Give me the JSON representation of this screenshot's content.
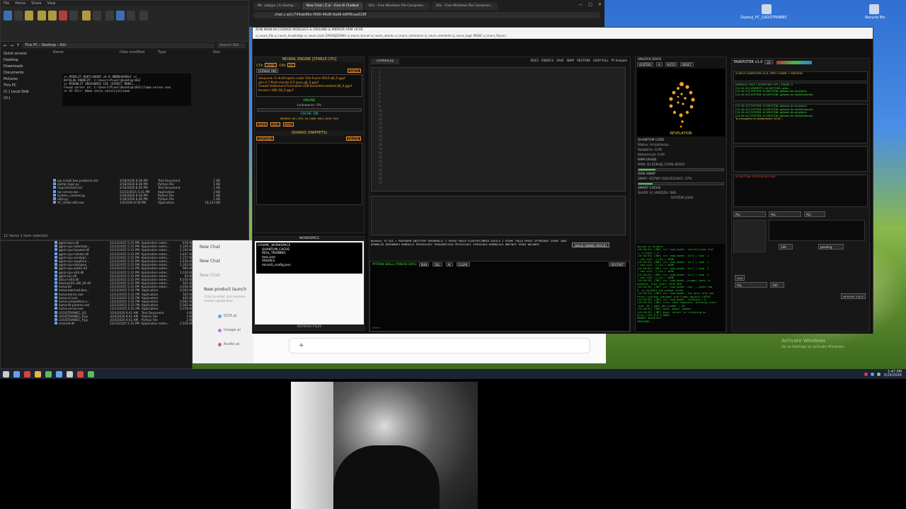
{
  "explorer": {
    "tabs": [
      "File",
      "Home",
      "Share",
      "View"
    ],
    "address": "This PC › Desktop › AGI",
    "search_placeholder": "Search AGI",
    "nav": [
      "Quick access",
      "Desktop",
      "Downloads",
      "Documents",
      "Pictures",
      "This PC",
      "(C:) Local Disk",
      "(D:)"
    ],
    "columns": [
      "Name",
      "Date modified",
      "Type",
      "Size"
    ],
    "files": [
      {
        "name": "pip install bee problems.txt",
        "date": "2/18/2026 8:36 PM",
        "type": "Text Document",
        "size": "1 KB"
      },
      {
        "name": "portal_logic.py",
        "date": "2/18/2026 8:36 PM",
        "type": "Python File",
        "size": "1 KB"
      },
      {
        "name": "requirements.txt",
        "date": "2/18/2026 8:36 PM",
        "type": "Text Document",
        "size": "1 KB"
      },
      {
        "name": "rpc-server.exe",
        "date": "12/23/2025 5:31 PM",
        "type": "Application",
        "size": "3 KB"
      },
      {
        "name": "system_context.py",
        "date": "2/18/2026 8:36 PM",
        "type": "Python File",
        "size": "1 KB"
      },
      {
        "name": "utils.py",
        "date": "2/18/2026 8:36 PM",
        "type": "Python File",
        "size": "1 KB"
      },
      {
        "name": "VC_redist.x64.exe",
        "date": "1/4/2026 8:56 PM",
        "type": "Application",
        "size": "18,124 KB"
      }
    ],
    "status": "11 items  1 item selected",
    "console_lines": [
      ">> MIROLIT BOOTLOADER v6.0 UNBREAKABLE <<",
      "KATALOG ROBOCZY: C:\\Users\\Pixel\\Desktop\\AGI",
      ">> MIROBLIT URUCHAMIA SIĘ (DIRECT MODE)...",
      "Found server at: C:\\Users\\Pixel\\Desktop\\AGI\\llama-server.exe",
      ">> AI Słir: Nowa sesja zainicjalizowa"
    ]
  },
  "explorer2": {
    "files": [
      {
        "name": "ggml-base.dll",
        "date": "12/23/2025 5:31 PM",
        "type": "Application exten...",
        "size": "678 KB"
      },
      {
        "name": "ggml-cpu-alderlake...",
        "date": "12/23/2025 5:31 PM",
        "type": "Application exten...",
        "size": "1,195 KB"
      },
      {
        "name": "ggml-cpu-haswell.dll",
        "date": "12/23/2025 5:31 PM",
        "type": "Application exten...",
        "size": "1,194 KB"
      },
      {
        "name": "ggml-cpu-icelake.dll",
        "date": "12/23/2025 5:31 PM",
        "type": "Application exten...",
        "size": "1,407 KB"
      },
      {
        "name": "ggml-cpu-sandybri...",
        "date": "12/23/2025 5:31 PM",
        "type": "Application exten...",
        "size": "1,157 KB"
      },
      {
        "name": "ggml-cpu-sapphire...",
        "date": "12/23/2025 5:31 PM",
        "type": "Application exten...",
        "size": "1,426 KB"
      },
      {
        "name": "ggml-cpu-skylakex...",
        "date": "12/23/2025 5:31 PM",
        "type": "Application exten...",
        "size": "1,303 KB"
      },
      {
        "name": "ggml-cpu-sse42.dll",
        "date": "12/23/2025 5:31 PM",
        "type": "Application exten...",
        "size": "965 KB"
      },
      {
        "name": "ggml-cpu-x64.dll",
        "date": "12/23/2025 5:31 PM",
        "type": "Application exten...",
        "size": "1,020 KB"
      },
      {
        "name": "ggml-rpc.dll",
        "date": "12/23/2025 5:31 PM",
        "type": "Application exten...",
        "size": "83 KB"
      },
      {
        "name": "libcurl-x64.dll",
        "date": "12/23/2025 5:31 PM",
        "type": "Application exten...",
        "size": "4,010 KB"
      },
      {
        "name": "libomp140.x86_64.dll",
        "date": "12/23/2025 5:31 PM",
        "type": "Application exten...",
        "size": "645 KB"
      },
      {
        "name": "llama.dll",
        "date": "12/23/2025 5:31 PM",
        "type": "Application exten...",
        "size": "2,656 KB"
      },
      {
        "name": "llama-batched-ben...",
        "date": "12/23/2025 5:31 PM",
        "type": "Application",
        "size": "2,003 KB"
      },
      {
        "name": "llama-bench.exe",
        "date": "12/23/2025 5:31 PM",
        "type": "Application",
        "size": "325 KB"
      },
      {
        "name": "llama-cli.exe",
        "date": "12/23/2025 5:31 PM",
        "type": "Application",
        "size": "405 KB"
      },
      {
        "name": "llama-completion.e...",
        "date": "12/23/2025 5:31 PM",
        "type": "Application",
        "size": "2,662 KB"
      },
      {
        "name": "llama-fit-params.exe",
        "date": "12/23/2025 5:31 PM",
        "type": "Application",
        "size": "2,562 KB"
      },
      {
        "name": "llama-server.exe",
        "date": "12/23/2025 5:31 PM",
        "type": "Application",
        "size": "2,378 KB"
      },
      {
        "name": "LOGISTRANIEC_LO...",
        "date": "3/24/2026 8:41 AM",
        "type": "Text Document",
        "size": "4 KB"
      },
      {
        "name": "LOGISTRANIEC_P.py",
        "date": "3/24/2026 8:41 AM",
        "type": "Python File",
        "size": "2 KB"
      },
      {
        "name": "LOGISTRANIEC_P.py",
        "date": "3/24/2026 8:41 AM",
        "type": "Python File",
        "size": "2 KB"
      },
      {
        "name": "mmmdl.dll",
        "date": "12/23/2025 5:31 PM",
        "type": "Application exten...",
        "size": "2,556 KB"
      }
    ]
  },
  "chat": {
    "sidebar_items": [
      "New Chat",
      "New Chat",
      "New Chat"
    ],
    "launch_title": "New product launch",
    "launch_sub": "Click to enter and explore model capabilities",
    "chips": [
      "OCR.ai",
      "Image.ai",
      "Audio.ai"
    ],
    "plus": "+"
  },
  "browser": {
    "tabs": [
      "Mc. zablyja | Ai dostop...",
      "New Chat | Z.ai - Free AI Chatbot",
      "iDiv - Free Windows File Compress...",
      "iDiv - Free Windows File Compress..."
    ],
    "url": "chat.z.ai/c/749ab86e-f566-46d8-8ad6-b6ff9caa028f",
    "min": "—",
    "max": "□",
    "close": "✕"
  },
  "app": {
    "title": "ZHM MAIN-IN COSMOS MODULES & GROUND & MIRROR ARM v9.00",
    "menu": "ui_neuro_file   ui_neuro_knowledge   ui_neuro_tools   ZARZĄDZANIA   ui_neuro_tunnel   ui_neuro_ubuntu   ui_neuro_commerce   ui_neuro_elements   ui_neuro_logic   MODE   ui_neuro_flavors",
    "neural": {
      "title": "NEURAL ENGINE [STABLE-CPU]",
      "ctx_label": "CTX:",
      "ctx_value": "4096",
      "cpu_label": "CPU",
      "cpu_value": "16",
      "stable": "[STABLE ON]",
      "ignite": "IGNITE",
      "models": [
        "deepseek-r1-distill-qwen-coder-32b-fusion-9010-q8_0.gguf",
        "glm-4.7-flash-claude-4.5-opus.q8_0.gguf",
        "Goedel-Statement-Formalizer-32B-SonnetAnnotated.Q8_0.gguf",
        "kenzorn-30B-Q8_0.gguf"
      ],
      "online": "ONLINE",
      "loading": "Ładowanie: 0%",
      "cache": "CACHE: ON",
      "cache_stats": "SEARCH: 64 | CPU: 16 | RAM: 64G | DISK: 50%",
      "safe": "SAFE",
      "bal": "BAL",
      "max": "MAX",
      "quarks_title": "QUARKS (SNIPPETS)",
      "capture": "CAPTURE",
      "delete": "DELETE"
    },
    "workspace": {
      "title": "WORKSPACE",
      "tree": [
        "COSMIC_WORKSPACE",
        "QUANTUM_CACHE",
        "REAL_TRAINING",
        "task.json",
        "VISUALS",
        "mirrolit_config.json"
      ],
      "refresh": "REFRESH FILES"
    },
    "editor": {
      "tab": "untitled.py",
      "toolbar": [
        "DOCS",
        "ENDOCS",
        "SAVE",
        "SNAP",
        "RESTORE",
        "LOOP FULL",
        "PY Analytix"
      ],
      "line_numbers": [
        "1",
        "2",
        "3",
        "4",
        "5",
        "6",
        "7",
        "8",
        "9",
        "10",
        "11",
        "12",
        "13",
        "14",
        "15",
        "16",
        "17",
        "18",
        "19",
        "20",
        "21",
        "22",
        "23",
        "24",
        "25",
        "26",
        "27"
      ],
      "message": "Wykonaj TE GUI z PENTOWYM OBCSYTEM INFORMACJI Z EFEKU PRAZU ELEKTRYCZNEGO ZASILA Z KTORE TRAJA PRZEZ IPTNIENIE SIEMI JAKO WIBRACJA KRZEMOWEJ WIBRACJI PRZESSLOSC TERAZNIEJSZA PRZYSZLOSC IYMIACACA WIBRACACA OBECNIE TERAZ WOJANIE",
      "send": "DALEJ [SEND] [ROCK]",
      "shell_title": "PYTHON SHELL [THREAD SAFE]",
      "shell_btns": [
        "RUN",
        "SEL",
        "AI",
        "CLEAR"
      ],
      "shell_restart": "RESTART",
      "prompt": ">>>"
    },
    "dock": {
      "title": "UNLOCK   DOCK",
      "actx": "ACKTRIX",
      "actx_val": "A",
      "auto": "AUTO",
      "reset": "RESET",
      "revelation": "REVELATION",
      "quantum": "QUANTUM CORE",
      "status": "Status: Inicjalizacja...",
      "spl": "Splątanie: 0.00",
      "koh": "Koherencja: 0.00",
      "ram": "RAM USAGE",
      "ram_state": "RAM: OCZEKUJĘ (STAN ZERO)",
      "ram_pct": 0.2,
      "disk": "DISK SWAP",
      "swap": "SWAP: OZYWY (SOLFEGGIO): 17%",
      "swap_pct": 0.17,
      "smart": "SMART CACHE",
      "slady": "ŚLADY: 0 | WIEDZA: 0KB",
      "sys_logs": "SYSTEM LOGS",
      "log_lines": [
        "warmup to disable",
        "[10:40:55] [INF] srv   load_model: initializing slot",
        "s, n_slots = 4",
        "[10:40:55] [INF] srv   load_model: id 0 | task -1",
        "| new slot, n_ctx = 4096",
        "[10:40:55] [INF] srv   load_model: id 1 | task -1",
        "| new slot, n_ctx = 4096",
        "[10:40:55] [INF] srv   load_model: id 2 | task -1",
        "| new slot, n_ctx = 4096",
        "[10:40:55] [INF] srv   load_model: id 3 | task -1",
        "| new slot, n_ctx = 4096",
        "[10:40:55] [INF] srv   load_model: prompt cache is",
        "enabled, size limit: 8192 MiB",
        "[10:40:55] [INF] srv   load_model: use '--cache-ram",
        "0' to disable the prompt cache",
        "[10:40:55] [INF] srv   load_model: for more info see",
        "https://github.com/ggml-org/llama.cpp/pull/16391",
        "[10:40:55] [INF] srv   load_model: thinking = 0",
        "[10:40:55] [INF] init: chat template, thinking_start",
        "_end: 18 | ggml_gen_prompt = 18",
        "[10:40:55] [INF] main: model loaded",
        "[10:40:55] [INF] main: server is listening on",
        "http://127.0.0.1:8080",
        "MEMORY ARCHITECT",
        "CHECKING..."
      ]
    },
    "taskputer": {
      "title": "TASKPUTER v1.0",
      "num": "20",
      "header_line": "AI SELF-COMPUTER v5.0  |  PRO CODER + SESSION",
      "lines1": [
        "[DEBUG]: SELF | SESSIONS: OFF | TASKS: 0",
        "[10:40:41] WYKRYTO: AI DECYZJA: goto...",
        "[10:40:41] SYSTEM: AI DECYZJA: gotowy do przyjęcia",
        "[10:40:41] SYSTEM: AI DECYZJA: gotowy do rejestrowania"
      ],
      "lines2": [
        "[10:40:41] SYSTEM: AI DECYZJA: gotowy do przyjęcia",
        "[10:40:41] SYSTEM: AI DECYZJA: gotowy do rejestrowania",
        "[10:40:41] SYSTEM: AI DECYZJA: gotowy do przyjęcia",
        "[10:40:41] SYSTEM: AI DECYZJA: gotowy do rejestrowania"
      ],
      "prompt_hint": "Ty przygotuj mi wiadomości na AI...",
      "status_line": "AI DECYZJA: SYSTEM DECYZJA",
      "all_a": "ALL",
      "all_b": "ALL",
      "all_c": "ALL",
      "pending": "pending",
      "num2": "100",
      "ram_lbl": "RAM",
      "memory_state": "MEMORY STATE"
    }
  },
  "taskbar": {
    "time": "1:47 PM",
    "date": "3/24/2026"
  },
  "watermark": {
    "line1": "Activate Windows",
    "line2": "Go to Settings to activate Windows."
  },
  "desktop": {
    "icon1": "Zapisuj_PC_LOGISTRANIEC",
    "icon2": "Recycle Bin"
  }
}
